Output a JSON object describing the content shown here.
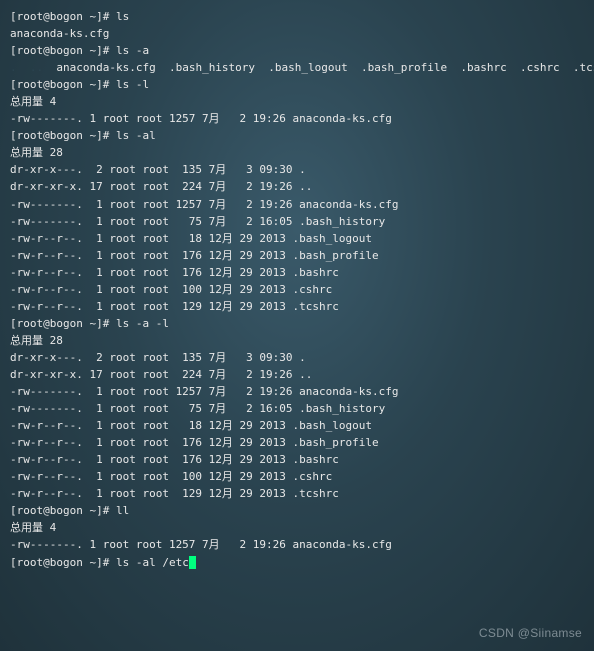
{
  "prompt": "[root@bogon ~]# ",
  "cmds": {
    "ls": "ls",
    "lsa": "ls -a",
    "lsl": "ls -l",
    "lsal": "ls -al",
    "lsa_l": "ls -a -l",
    "ll": "ll",
    "lsal_etc": "ls -al /etc"
  },
  "out_ls": "anaconda-ks.cfg",
  "out_lsa_dots": ".  ..",
  "out_lsa_rest": "  anaconda-ks.cfg  .bash_history  .bash_logout  .bash_profile  .bashrc  .cshrc  .tcshrc",
  "total4": "总用量 4",
  "total28": "总用量 28",
  "ls_l_line": "-rw-------. 1 root root 1257 7月   2 19:26 anaconda-ks.cfg",
  "ls_al": [
    "dr-xr-x---.  2 root root  135 7月   3 09:30 .",
    "dr-xr-xr-x. 17 root root  224 7月   2 19:26 ..",
    "-rw-------.  1 root root 1257 7月   2 19:26 anaconda-ks.cfg",
    "-rw-------.  1 root root   75 7月   2 16:05 .bash_history",
    "-rw-r--r--.  1 root root   18 12月 29 2013 .bash_logout",
    "-rw-r--r--.  1 root root  176 12月 29 2013 .bash_profile",
    "-rw-r--r--.  1 root root  176 12月 29 2013 .bashrc",
    "-rw-r--r--.  1 root root  100 12月 29 2013 .cshrc",
    "-rw-r--r--.  1 root root  129 12月 29 2013 .tcshrc"
  ],
  "watermark": "CSDN @Siinamse"
}
